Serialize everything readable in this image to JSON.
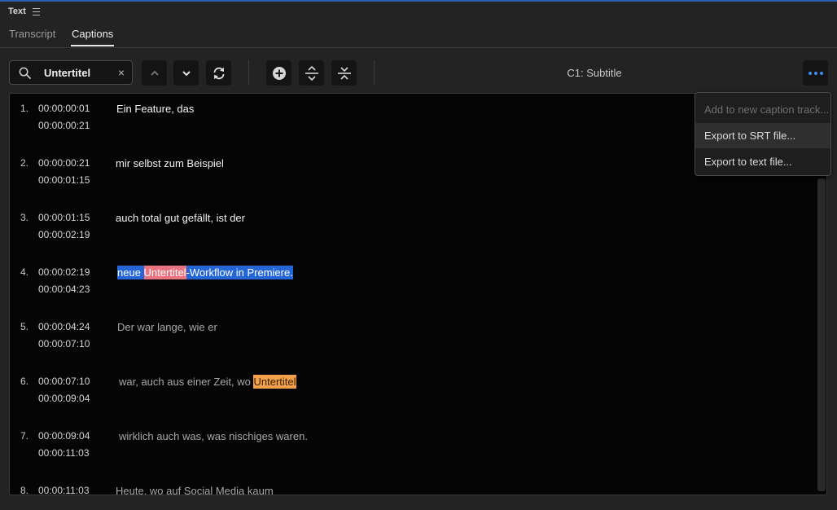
{
  "panel": {
    "title": "Text"
  },
  "tabs": [
    {
      "label": "Transcript",
      "active": false
    },
    {
      "label": "Captions",
      "active": true
    }
  ],
  "search": {
    "value": "Untertitel",
    "clear": "×"
  },
  "track_label": "C1: Subtitle",
  "colors": {
    "accent": "#3f8df0",
    "selection": "#2566d6",
    "current_match": "#e9747f",
    "other_match": "#f2a14a"
  },
  "captions": [
    {
      "num": "1.",
      "start": "00:00:00:01",
      "end": "00:00:00:21",
      "text": "Ein Feature, das",
      "dim": false
    },
    {
      "num": "2.",
      "start": "00:00:00:21",
      "end": "00:00:01:15",
      "text": "mir selbst zum Beispiel",
      "dim": false
    },
    {
      "num": "3.",
      "start": "00:00:01:15",
      "end": "00:00:02:19",
      "text": "auch total gut gefällt, ist der",
      "dim": false
    },
    {
      "num": "4.",
      "start": "00:00:02:19",
      "end": "00:00:04:23",
      "pre": "neue ",
      "match": "Untertitel",
      "post": "-Workflow in Premiere.",
      "selected": true
    },
    {
      "num": "5.",
      "start": "00:00:04:24",
      "end": "00:00:07:10",
      "text": "Der war lange, wie er",
      "dim": true
    },
    {
      "num": "6.",
      "start": "00:00:07:10",
      "end": "00:00:09:04",
      "pre": "war, auch aus einer Zeit, wo ",
      "match": "Untertitel",
      "dim": true
    },
    {
      "num": "7.",
      "start": "00:00:09:04",
      "end": "00:00:11:03",
      "text": "wirklich auch was, was nischiges waren.",
      "dim": true
    },
    {
      "num": "8.",
      "start": "00:00:11:03",
      "end": "",
      "text": "Heute, wo auf Social Media kaum",
      "dim": true
    }
  ],
  "menu": {
    "items": [
      {
        "label": "Add to new caption track...",
        "disabled": true
      },
      {
        "label": "Export to SRT file...",
        "disabled": false,
        "hover": true
      },
      {
        "label": "Export to text file...",
        "disabled": false
      }
    ]
  },
  "icons": {
    "search": "search-icon",
    "clear": "close-icon",
    "up": "chevron-up-icon",
    "down": "chevron-down-icon",
    "replace": "refresh-icon",
    "add": "plus-circle-icon",
    "split": "split-icon",
    "merge": "merge-icon",
    "more": "more-icon"
  }
}
